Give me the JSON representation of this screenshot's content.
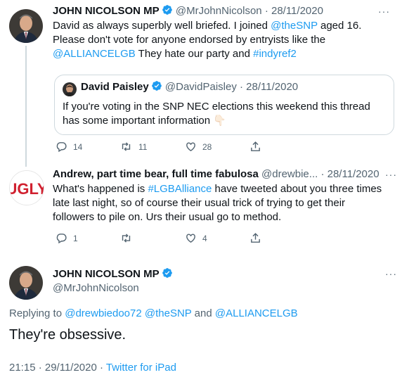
{
  "tweet1": {
    "display_name": "JOHN NICOLSON MP",
    "handle": "@MrJohnNicolson",
    "date": "· 28/11/2020",
    "line1_pre": "David as always superbly well briefed. I joined ",
    "line1_mention": "@theSNP",
    "line1_post": " aged 16.",
    "line2": "Please don't vote for anyone endorsed by entryists like the",
    "line3_mention": "@ALLIANCELGB",
    "line3_mid": " They hate our party and ",
    "line3_hashtag": "#indyref2",
    "more": "···",
    "quote": {
      "display_name": "David Paisley",
      "handle": "@DavidPaisley",
      "date": "· 28/11/2020",
      "line1": "If you're voting in the SNP NEC elections this weekend this thread",
      "line2": "has some important information",
      "emoji": "👇🏻"
    },
    "replies": "14",
    "retweets": "11",
    "likes": "28"
  },
  "tweet2": {
    "display_name": "Andrew, part time bear, full time fabulosa",
    "handle": "@drewbie...",
    "date": "· 28/11/2020",
    "avatar_text": "UGLY",
    "line1_pre": "What's happened is ",
    "line1_hashtag": "#LGBAlliance",
    "line1_post": " have tweeted about you three times",
    "line2": "late last night, so of course their usual trick of trying to get their",
    "line3": "followers to pile on. Urs their usual go to method.",
    "more": "···",
    "replies": "1",
    "retweets": "",
    "likes": "4"
  },
  "tweet3": {
    "display_name": "JOHN NICOLSON MP",
    "handle": "@MrJohnNicolson",
    "more": "···",
    "replying_to": "Replying to",
    "mention1": "@drewbiedoo72",
    "mention2": "@theSNP",
    "and": " and ",
    "mention3": "@ALLIANCELGB",
    "body": "They're obsessive.",
    "time": "21:15 · 29/11/2020 · ",
    "source": "Twitter for iPad"
  },
  "colors": {
    "accent": "#1d9bf0",
    "muted": "#536471",
    "ugly_red": "#d0202f"
  }
}
